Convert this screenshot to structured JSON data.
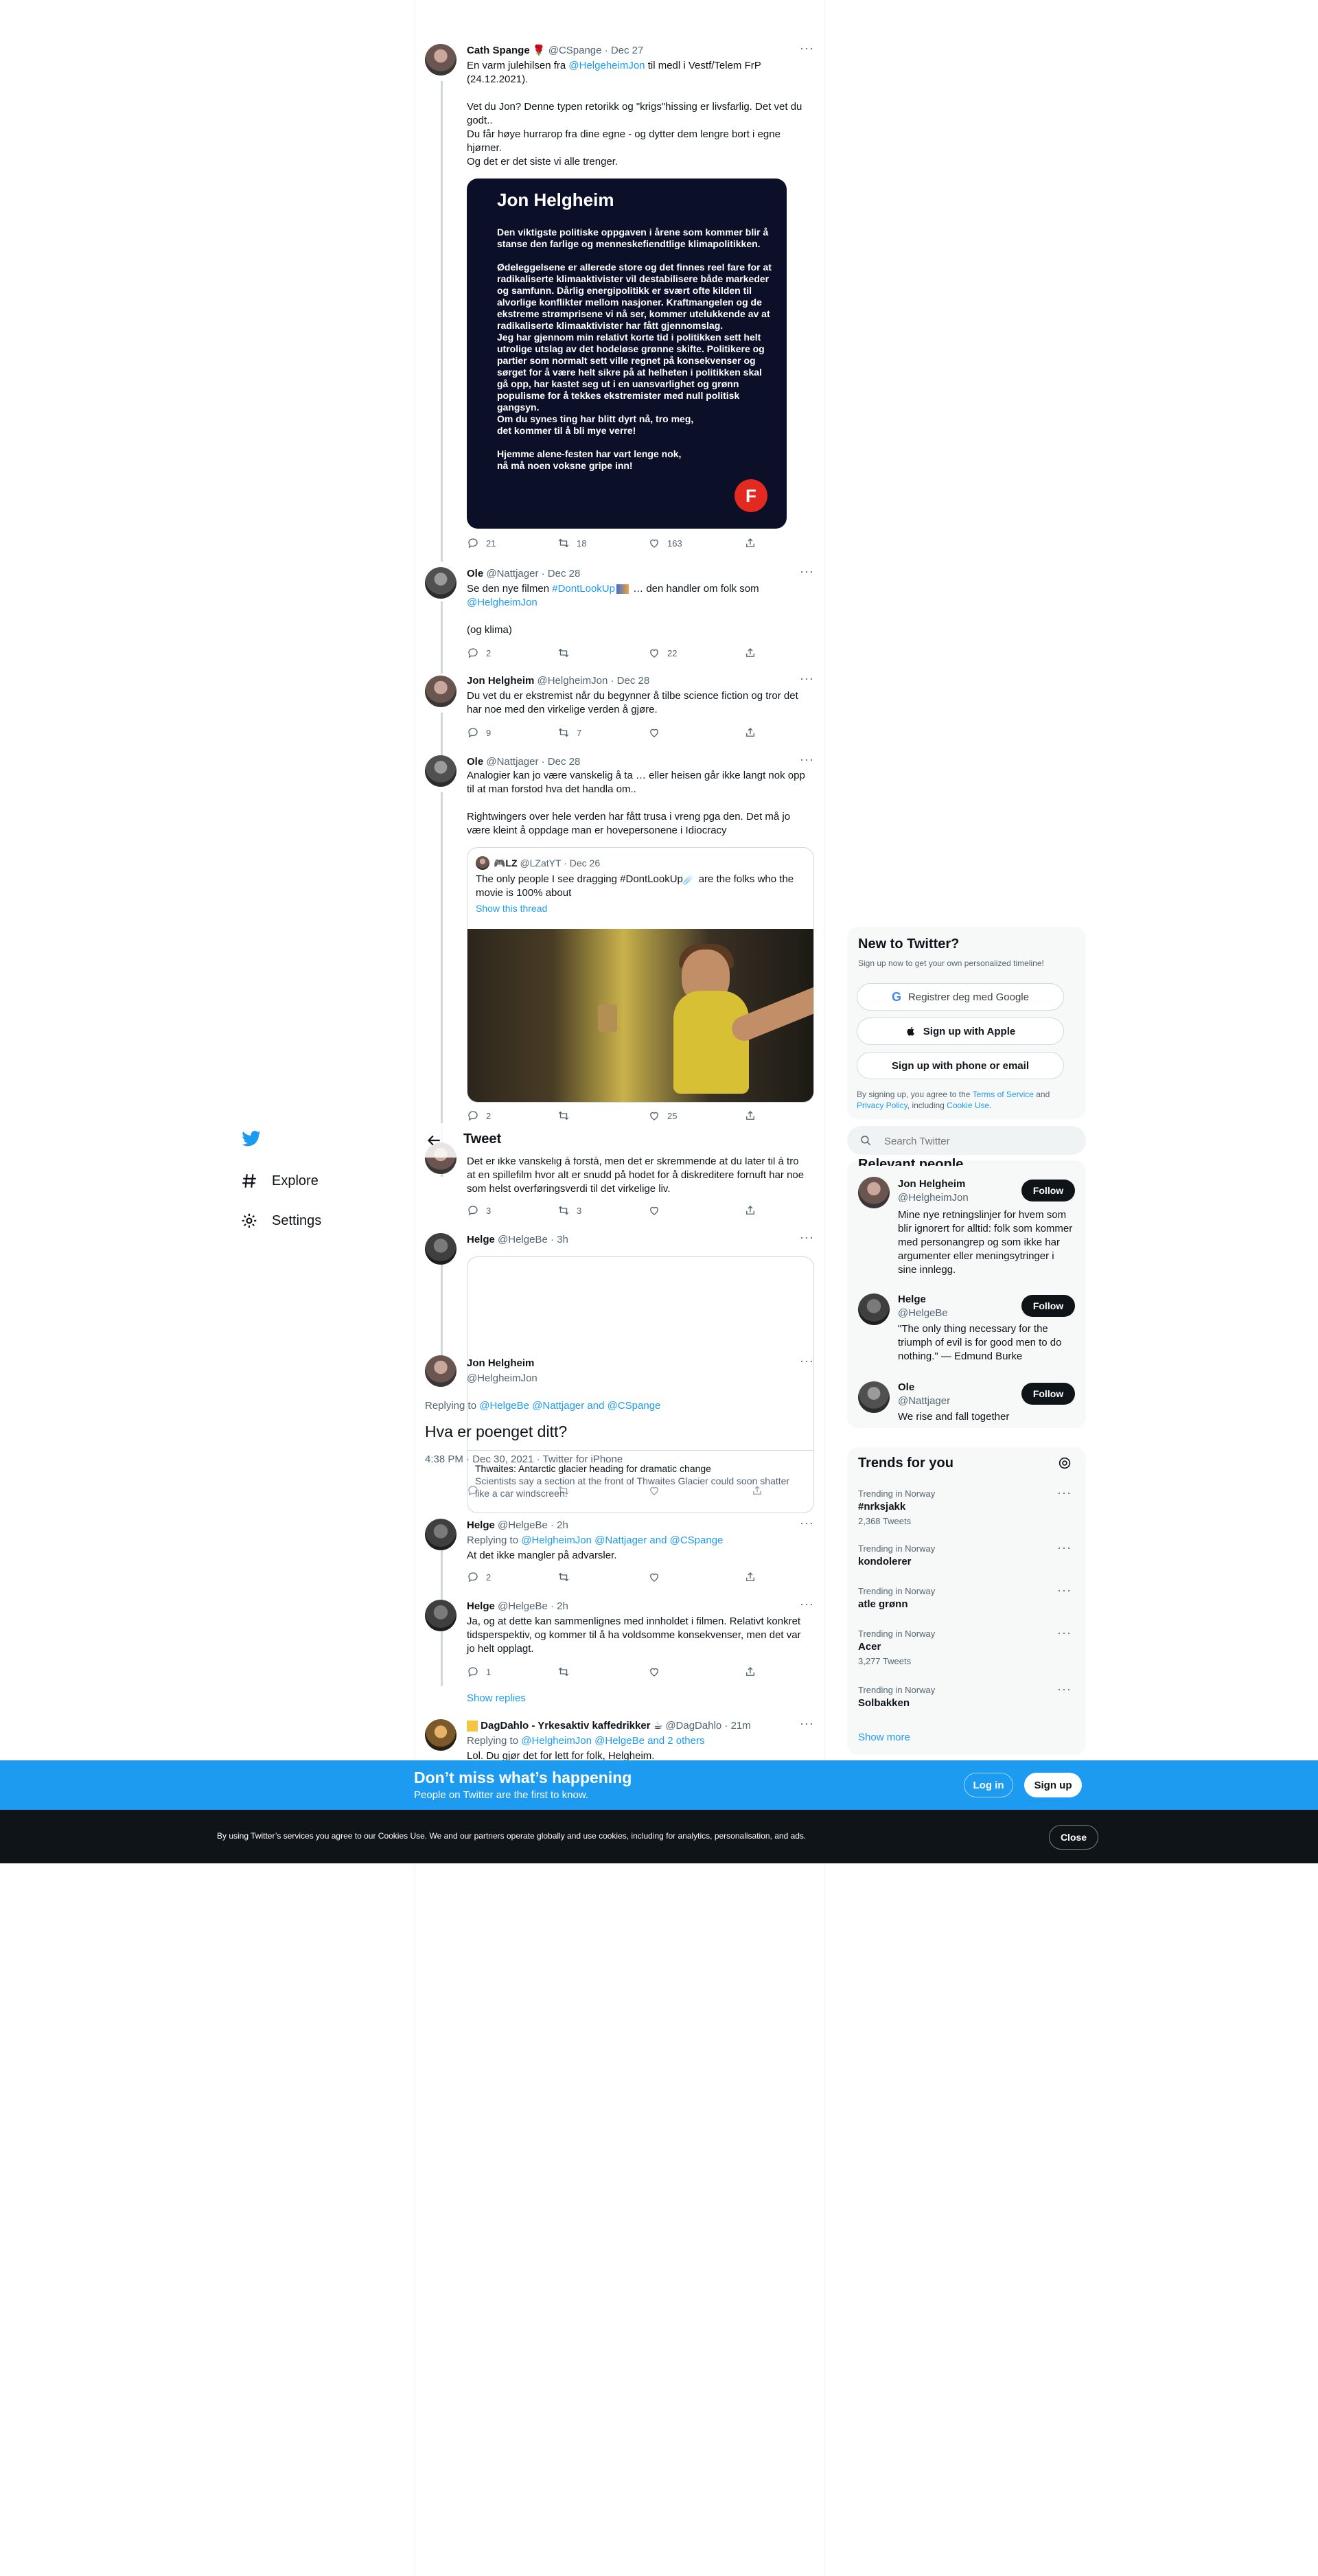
{
  "sidebar": {
    "items": [
      {
        "label": "Explore",
        "icon": "hashtag-icon"
      },
      {
        "label": "Settings",
        "icon": "gear-icon"
      }
    ]
  },
  "header": {
    "title": "Tweet"
  },
  "tweets": [
    {
      "name": "Cath Spange",
      "emoji": "🌹",
      "handle": "@CSpange",
      "date": "Dec 27",
      "text_pre": "En varm julehilsen fra ",
      "mention": "@HelgeheimJon",
      "text_post": " til medl i Vestf/Telem FrP (24.12.2021).",
      "lines": [
        "Vet du Jon? Denne typen retorikk og \"krigs\"hissing er livsfarlig. Det vet du godt..",
        "Du får høye hurrarop fra dine egne - og dytter dem lengre bort i egne hjørner.",
        "Og det er det siste vi alle trenger."
      ],
      "card": {
        "title": "Jon Helgheim",
        "body": "Den viktigste politiske oppgaven i årene som kommer blir å stanse den farlige og menneskefiendtlige klimapolitikken.\n\nØdeleggelsene er allerede store og det finnes reel fare for at radikaliserte klimaaktivister vil destabilisere både markeder og samfunn. Dårlig energipolitikk er svært ofte kilden til alvorlige konflikter mellom nasjoner. Kraftmangelen og de ekstreme strømprisene vi nå ser, kommer utelukkende av at radikaliserte klimaaktivister har fått gjennomslag.\nJeg har gjennom min relativt korte tid i politikken sett helt utrolige utslag av det hodeløse grønne skifte. Politikere og partier som normalt sett ville regnet på konsekvenser og sørget for å være helt sikre på at helheten i politikken skal gå opp, har kastet seg ut i en uansvarlighet og grønn populisme for å tekkes ekstremister med null politisk gangsyn.\nOm du synes ting har blitt dyrt nå, tro meg,\ndet kommer til å bli mye verre!\n\nHjemme alene-festen har vart lenge nok,\nnå må noen voksne gripe inn!",
        "logo": "F"
      },
      "replies": "21",
      "retweets": "18",
      "likes": "163"
    },
    {
      "name": "Ole",
      "handle": "@Nattjager",
      "date": "Dec 28",
      "line1_pre": "Se den nye filmen ",
      "hashtag": "#DontLookUp",
      "line1_post": " … den handler om folk som",
      "mention": "@HelgheimJon",
      "line2": "(og klima)",
      "replies": "2",
      "retweets": "",
      "likes": "22"
    },
    {
      "name": "Jon Helgheim",
      "handle": "@HelgheimJon",
      "date": "Dec 28",
      "text": "Du vet du er ekstremist når du begynner å tilbe science fiction og tror det har noe med den virkelige verden å gjøre.",
      "replies": "9",
      "retweets": "7",
      "likes": ""
    },
    {
      "name": "Ole",
      "handle": "@Nattjager",
      "date": "Dec 28",
      "text1": "Analogier kan jo være vanskelig å ta … eller heisen går ikke langt nok opp til at man forstod hva det handla om..",
      "text2": "Rightwingers over hele verden har fått trusa i vreng pga den. Det må jo være kleint å oppdage man er hovepersonene i Idiocracy",
      "quote": {
        "name": "🎮LZ",
        "handle": "@LZatYT",
        "date": "Dec 26",
        "text": "The only people I see dragging #DontLookUp☄️ are the folks who the movie is 100% about",
        "show_thread": "Show this thread"
      },
      "replies": "2",
      "retweets": "",
      "likes": "25"
    },
    {
      "text": "Det er ikke vanskelig å forstå, men det er skremmende at du later til å tro at en spillefilm hvor alt er snudd på hodet for å diskreditere fornuft har noe som helst overføringsverdi til det virkelige liv.",
      "replies": "3",
      "retweets": "3",
      "likes": ""
    },
    {
      "name": "Helge",
      "handle": "@HelgeBe",
      "time": "3h"
    }
  ],
  "main_tweet": {
    "name": "Jon Helgheim",
    "handle": "@HelgheimJon",
    "replying_label": "Replying to",
    "replying_to": "@HelgeBe @Nattjager and @CSpange",
    "text": "Hva er poenget ditt?",
    "meta": "4:38 PM · Dec 30, 2021 · Twitter for iPhone",
    "link_card_title": "Thwaites: Antarctic glacier heading for dramatic change",
    "link_card_desc": "Scientists say a section at the front of Thwaites Glacier could soon shatter like a car windscreen."
  },
  "replies": [
    {
      "name": "Helge",
      "handle": "@HelgeBe",
      "time": "2h",
      "replying_label": "Replying to",
      "replying_to": "@HelgheimJon @Nattjager and @CSpange",
      "text": "At det ikke mangler på advarsler.",
      "replies": "2",
      "retweets": "",
      "likes": ""
    },
    {
      "name": "Helge",
      "handle": "@HelgeBe",
      "time": "2h",
      "text": "Ja, og at dette kan sammenlignes med innholdet i filmen. Relativt konkret tidsperspektiv, og kommer til å ha voldsomme konsekvenser, men det var jo helt opplagt.",
      "replies": "1",
      "retweets": "",
      "likes": ""
    },
    {
      "show_replies": "Show replies"
    },
    {
      "name": "DagDahlo - Yrkesaktiv kaffedrikker ☕",
      "handle": "@DagDahlo",
      "time": "21m",
      "replying_label": "Replying to",
      "replying_to": "@HelgheimJon @HelgeBe and 2 others",
      "text": "Lol. Du gjør det for lett for folk, Helgheim."
    }
  ],
  "signup": {
    "title": "New to Twitter?",
    "subtitle": "Sign up now to get your own personalized timeline!",
    "google": "Registrer deg med Google",
    "apple": "Sign up with Apple",
    "phone": "Sign up with phone or email",
    "terms_pre": "By signing up, you agree to the ",
    "terms": "Terms of Service",
    "terms_mid": " and",
    "privacy": "Privacy Policy",
    "terms_mid2": ", including ",
    "cookie": "Cookie Use",
    "terms_end": "."
  },
  "search": {
    "placeholder": "Search Twitter"
  },
  "relevant_people": {
    "title": "Relevant people",
    "people": [
      {
        "name": "Jon Helgheim",
        "handle": "@HelgheimJon",
        "bio": "Mine nye retningslinjer for hvem som blir ignorert for alltid: folk som kommer med personangrep og som ikke har argumenter eller meningsytringer i sine innlegg.",
        "button": "Follow"
      },
      {
        "name": "Helge",
        "handle": "@HelgeBe",
        "bio": "\"The only thing necessary for the triumph of evil is for good men to do nothing.\" — Edmund Burke",
        "button": "Follow"
      },
      {
        "name": "Ole",
        "handle": "@Nattjager",
        "bio": "We rise and fall together",
        "button": "Follow"
      }
    ]
  },
  "trends": {
    "title": "Trends for you",
    "items": [
      {
        "context": "Trending in Norway",
        "name": "#nrksjakk",
        "count": "2,368 Tweets"
      },
      {
        "context": "Trending in Norway",
        "name": "kondolerer",
        "count": ""
      },
      {
        "context": "Trending in Norway",
        "name": "atle grønn",
        "count": ""
      },
      {
        "context": "Trending in Norway",
        "name": "Acer",
        "count": "3,277 Tweets"
      },
      {
        "context": "Trending in Norway",
        "name": "Solbakken",
        "count": ""
      }
    ],
    "show_more": "Show more"
  },
  "bottom_bar": {
    "title": "Don’t miss what’s happening",
    "subtitle": "People on Twitter are the first to know.",
    "login": "Log in",
    "signup": "Sign up"
  },
  "cookie_bar": {
    "text": "By using Twitter’s services you agree to our Cookies Use. We and our partners operate globally and use cookies, including for analytics, personalisation, and ads.",
    "close": "Close"
  },
  "colors": {
    "accent": "#1d9bf0",
    "text": "#0f1419",
    "muted": "#536471",
    "card": "#0c0f28",
    "frp_red": "#e32a20"
  }
}
